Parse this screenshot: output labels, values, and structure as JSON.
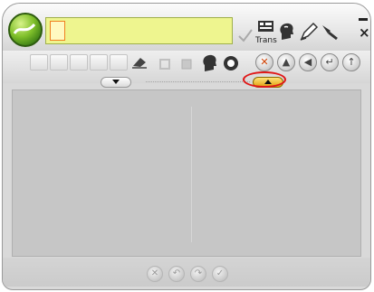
{
  "header": {
    "input_value": "",
    "trans_label": "Trans"
  },
  "icons": {
    "logo": "app-logo-icon",
    "check": "checkmark-icon",
    "trans": "trans-icon",
    "speak": "speak-head-icon",
    "pen": "pen-icon",
    "pin": "pin-icon",
    "eraser": "eraser-icon",
    "stop": "stop-icon",
    "head": "head-icon",
    "audio": "audio-icon",
    "cancel": "cancel-icon",
    "up": "up-icon",
    "back": "back-icon",
    "enter": "enter-icon",
    "shift": "shift-icon"
  },
  "colors": {
    "input_bg": "#eef58f",
    "highlight": "#e01818",
    "toggle_right": "#f0b020"
  },
  "bottom": {
    "actions": [
      "cancel",
      "undo",
      "redo",
      "confirm"
    ]
  }
}
